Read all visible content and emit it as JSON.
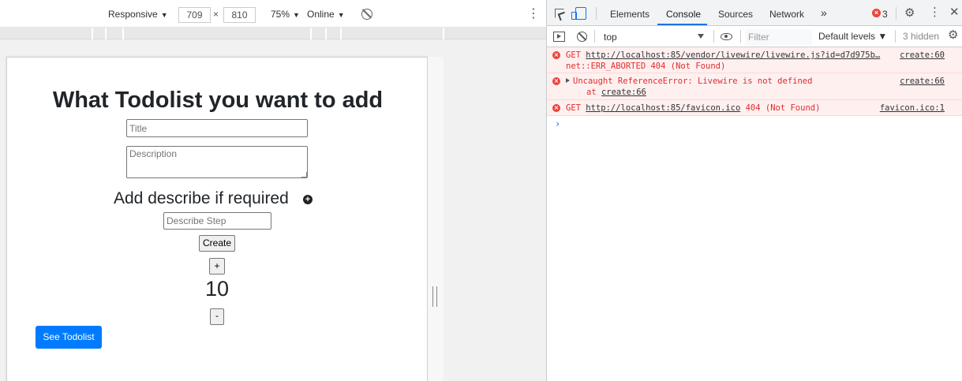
{
  "device_toolbar": {
    "device": "Responsive",
    "width": "709",
    "height": "810",
    "times": "×",
    "zoom": "75%",
    "network": "Online"
  },
  "page": {
    "title": "What Todolist you want to add",
    "title_placeholder": "Title",
    "description_placeholder": "Description",
    "describe_heading": "Add describe if required",
    "step_placeholder": "Describe Step",
    "create_label": "Create",
    "increment_label": "+",
    "counter": "10",
    "decrement_label": "-",
    "see_todolist_label": "See Todolist"
  },
  "devtools": {
    "tabs": [
      "Elements",
      "Console",
      "Sources",
      "Network"
    ],
    "more_tabs": "»",
    "error_count": "3",
    "console_toolbar": {
      "context": "top",
      "filter_placeholder": "Filter",
      "levels": "Default levels ▼",
      "hidden": "3 hidden"
    },
    "messages": [
      {
        "prefix": "GET ",
        "url": "http://localhost:85/vendor/livewire/livewire.js?id=d7d975b…",
        "line2": "net::ERR_ABORTED 404 (Not Found)",
        "source": "create:60"
      },
      {
        "text": "Uncaught ReferenceError: Livewire is not defined",
        "line2_prefix": "at ",
        "line2_link": "create:66",
        "source": "create:66"
      },
      {
        "prefix": "GET ",
        "url": "http://localhost:85/favicon.ico",
        "suffix": " 404 (Not Found)",
        "source": "favicon.ico:1"
      }
    ],
    "prompt": "›"
  },
  "colors": {
    "primary_button": "#007bff",
    "error_text": "#e12d2d",
    "error_bg": "#fff0f0",
    "active_tab_underline": "#1a73e8"
  }
}
